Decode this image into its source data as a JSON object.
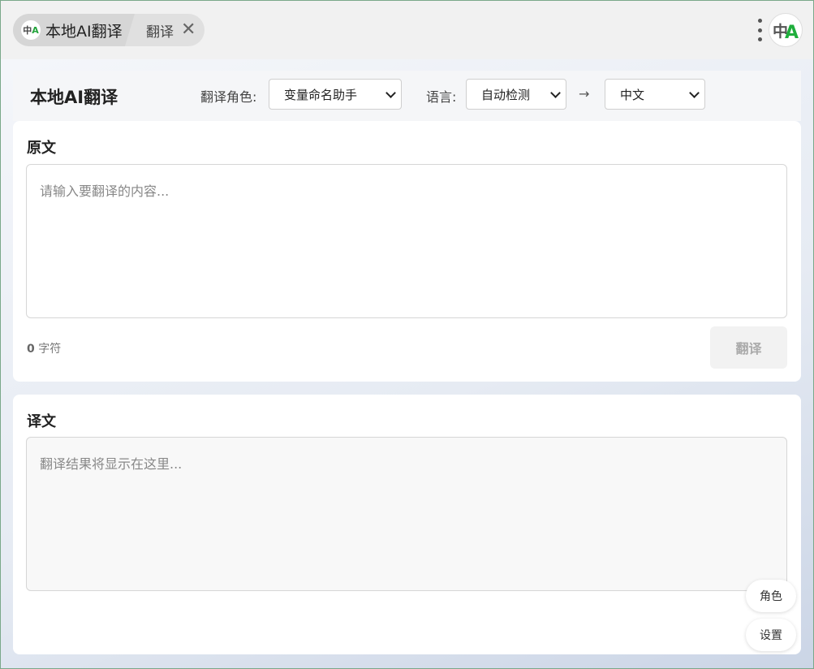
{
  "tabbar": {
    "logo_text": "中",
    "logo_accent": "A",
    "main_tab_label": "本地AI翻译",
    "sub_tab_label": "翻译",
    "close_symbol": "✕"
  },
  "header": {
    "title": "本地AI翻译",
    "role_label": "翻译角色:",
    "role_value": "变量命名助手",
    "lang_label": "语言:",
    "source_lang": "自动检测",
    "arrow": "→",
    "target_lang": "中文"
  },
  "source": {
    "title": "原文",
    "placeholder": "请输入要翻译的内容...",
    "char_count": "0",
    "char_unit": "字符",
    "translate_button": "翻译"
  },
  "target": {
    "title": "译文",
    "placeholder": "翻译结果将显示在这里..."
  },
  "floating": {
    "role_button": "角色",
    "settings_button": "设置"
  },
  "colors": {
    "accent_green": "#1fae3c",
    "disabled_button_bg": "#f2f2f2"
  }
}
